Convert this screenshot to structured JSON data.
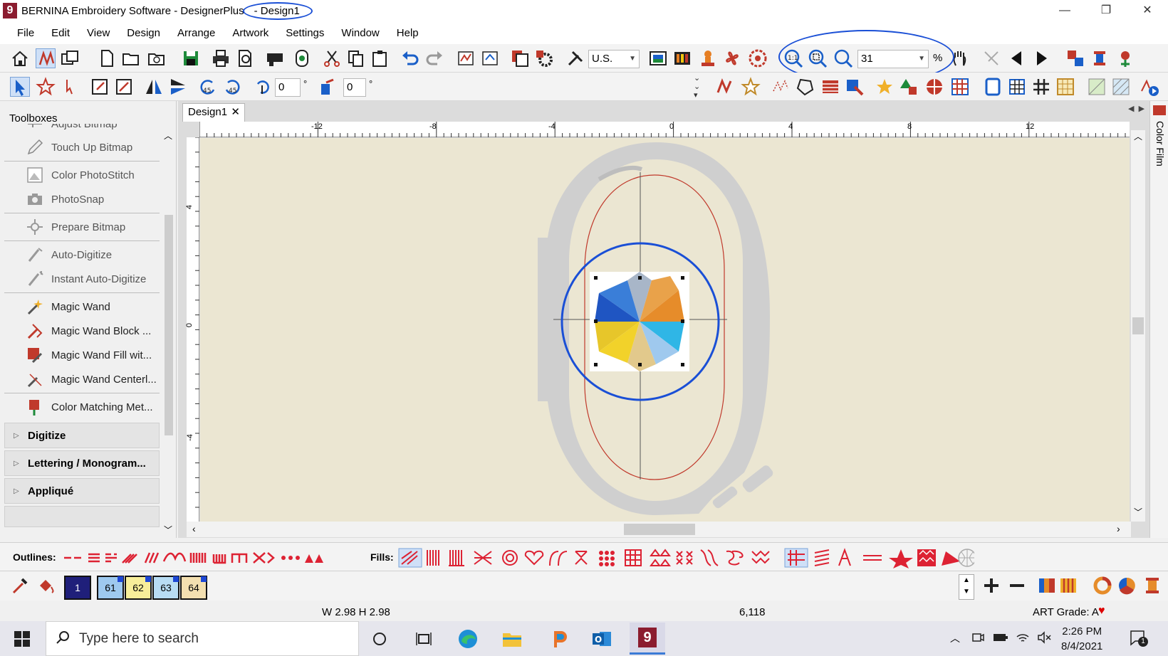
{
  "window": {
    "title_prefix": "BERNINA Embroidery Software - DesignerPlus",
    "title_doc": "- Design1",
    "app_icon_glyph": "9",
    "controls": [
      "minimize-icon",
      "restore-icon",
      "close-icon"
    ]
  },
  "menu": [
    "File",
    "Edit",
    "View",
    "Design",
    "Arrange",
    "Artwork",
    "Settings",
    "Window",
    "Help"
  ],
  "toolbar1": {
    "units_select": "U.S.",
    "zoom_value": "31",
    "zoom_unit": "%"
  },
  "toolbar2": {
    "angle1_value": "0",
    "angle1_unit": "°",
    "angle2_value": "0",
    "angle2_unit": "°"
  },
  "left_panel": {
    "header": "Toolboxes",
    "items": [
      {
        "label": "Adjust Bitmap",
        "icon": "adjust-bitmap-icon"
      },
      {
        "label": "Touch Up Bitmap",
        "icon": "pencil-icon"
      },
      {
        "label": "Color PhotoStitch",
        "icon": "photostitch-icon"
      },
      {
        "label": "PhotoSnap",
        "icon": "camera-icon"
      },
      {
        "label": "Prepare Bitmap",
        "icon": "prepare-bitmap-icon"
      },
      {
        "label": "Auto-Digitize",
        "icon": "auto-digitize-icon"
      },
      {
        "label": "Instant Auto-Digitize",
        "icon": "instant-auto-digitize-icon"
      },
      {
        "label": "Magic Wand",
        "icon": "magic-wand-icon"
      },
      {
        "label": "Magic Wand Block ...",
        "icon": "magic-wand-block-icon"
      },
      {
        "label": "Magic Wand Fill wit...",
        "icon": "magic-wand-fill-icon"
      },
      {
        "label": "Magic Wand Centerl...",
        "icon": "magic-wand-centerline-icon"
      },
      {
        "label": "Color Matching Met...",
        "icon": "color-matching-icon"
      }
    ],
    "groups": [
      "Digitize",
      "Lettering / Monogram...",
      "Appliqué"
    ]
  },
  "document": {
    "tab_label": "Design1",
    "hruler_labels": [
      "-12",
      "-8",
      "-4",
      "0",
      "4",
      "8",
      "12"
    ],
    "vruler_labels": [
      "4",
      "0",
      "-4"
    ]
  },
  "side_strip": {
    "label": "Color Film"
  },
  "fill_bar": {
    "outlines_label": "Outlines:",
    "fills_label": "Fills:"
  },
  "color_bar": {
    "swatches": [
      {
        "label": "1",
        "bg": "#1f1f7a",
        "fg": "#ffffff"
      },
      {
        "label": "61",
        "bg": "#9ec9ef",
        "fg": "#000000"
      },
      {
        "label": "62",
        "bg": "#f7ee9a",
        "fg": "#000000"
      },
      {
        "label": "63",
        "bg": "#b8dcf3",
        "fg": "#000000"
      },
      {
        "label": "64",
        "bg": "#f3dfb0",
        "fg": "#000000"
      }
    ]
  },
  "status": {
    "dimensions": "W 2.98 H 2.98",
    "coords": "6,118",
    "art_grade": "ART Grade: A"
  },
  "taskbar": {
    "search_placeholder": "Type here to search",
    "time": "2:26 PM",
    "date": "8/4/2021",
    "notification_count": "1"
  },
  "colors": {
    "accent_annotation": "#1a4fd6",
    "hoop_gray": "#cfcfcf",
    "canvas_bg": "#ebe6d2",
    "stitch_red": "#c0392b"
  }
}
